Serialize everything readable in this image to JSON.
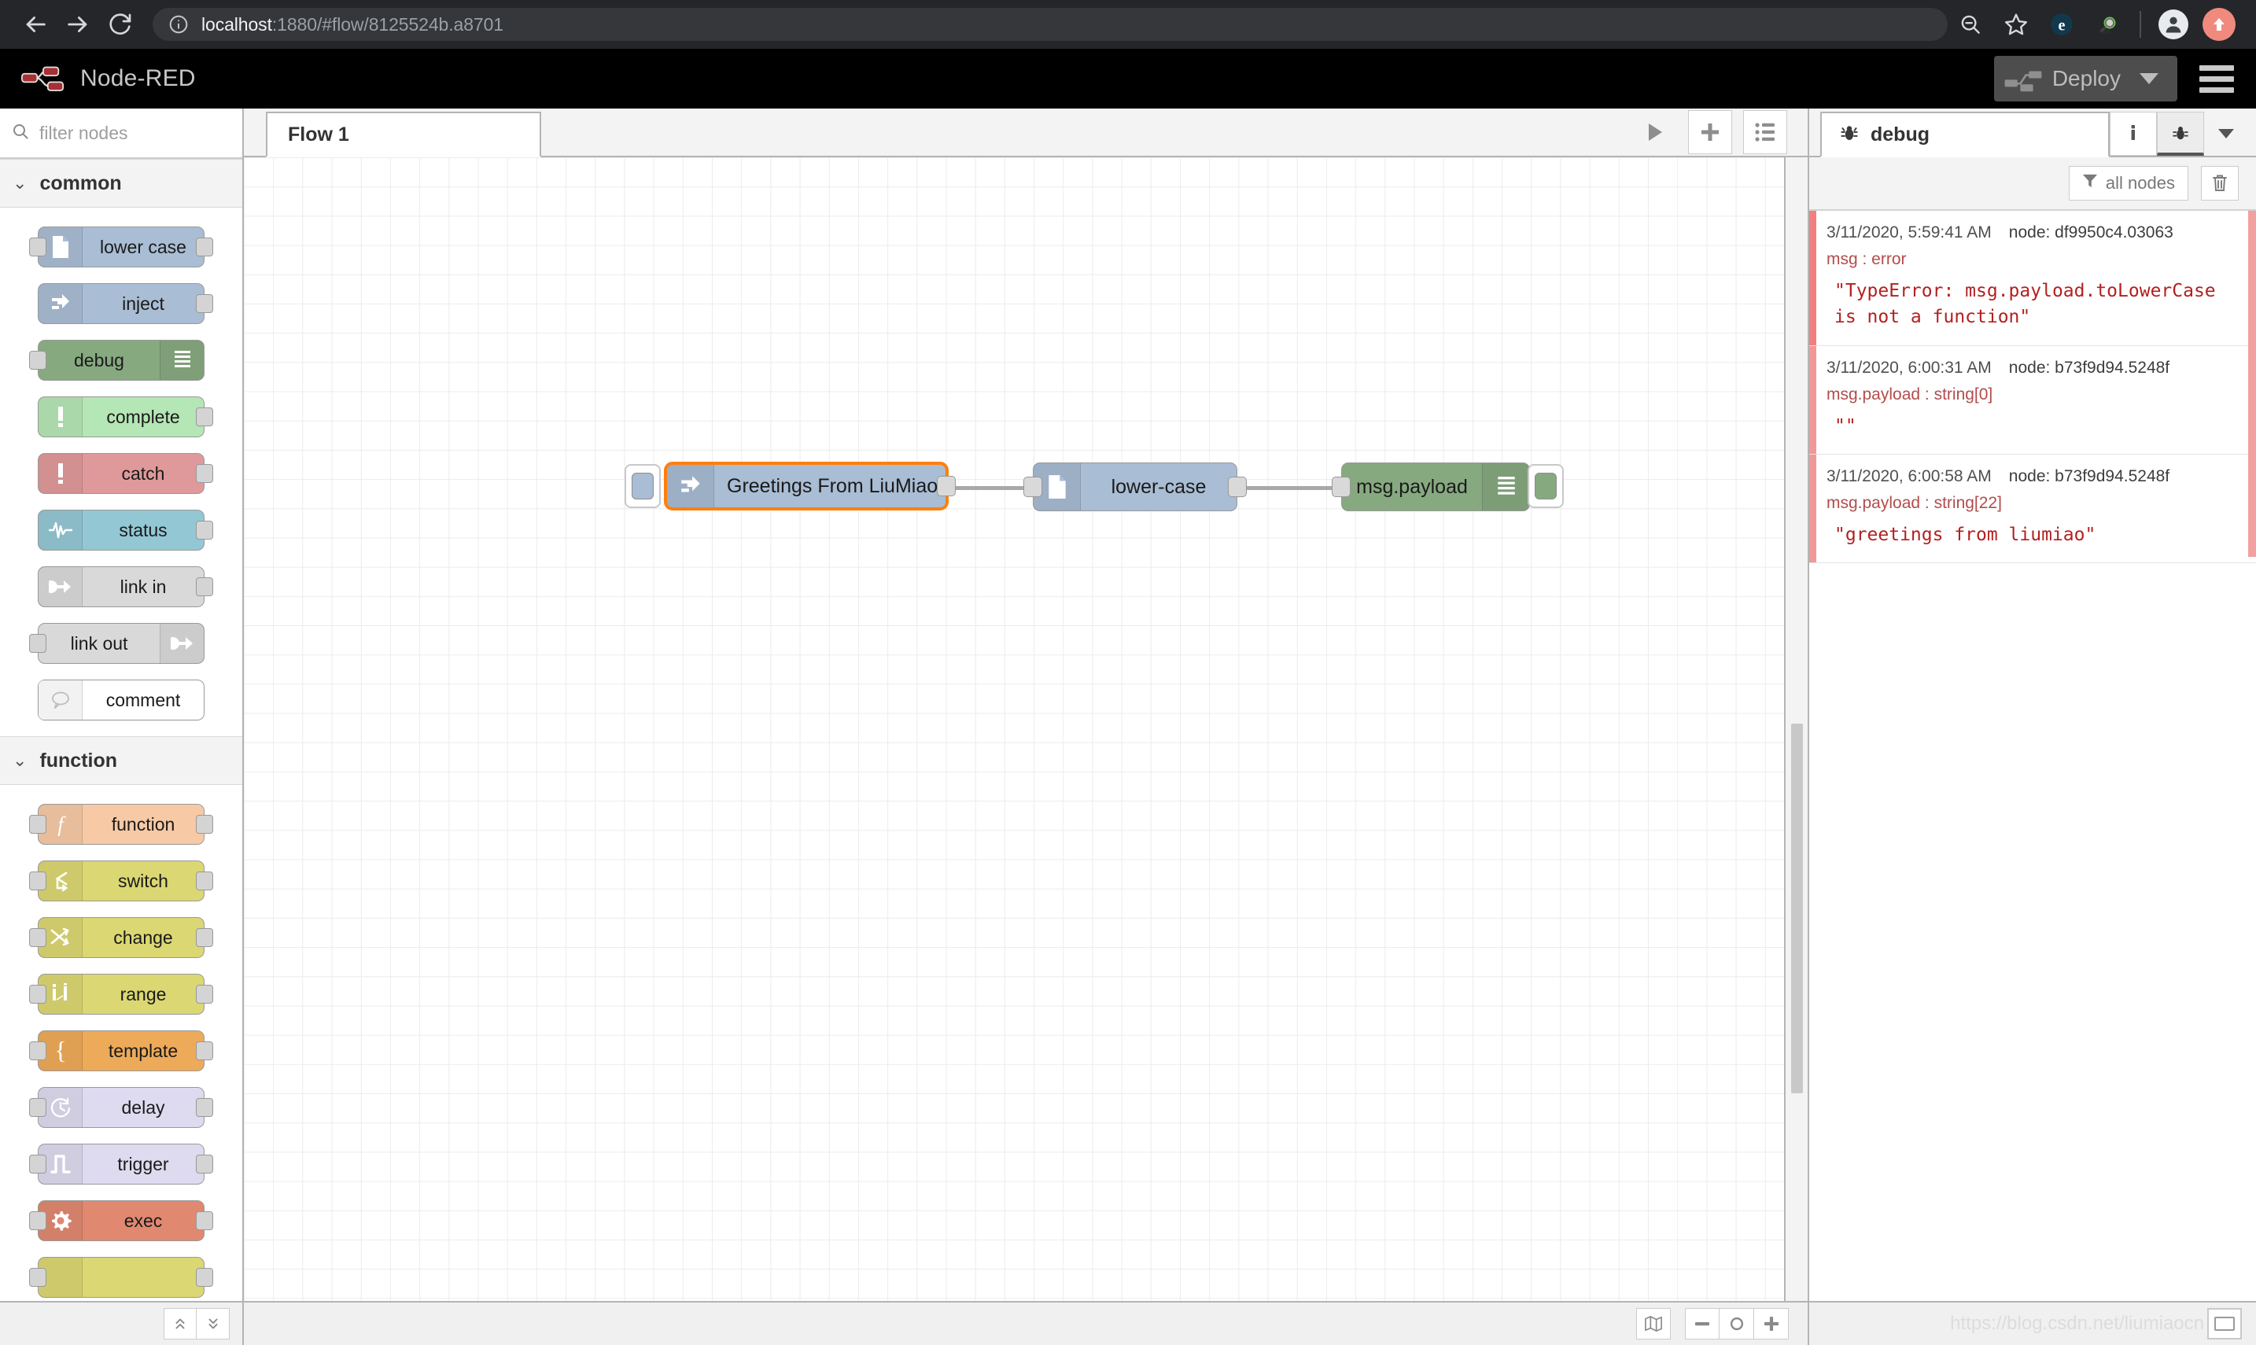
{
  "browser": {
    "url_host": "localhost",
    "url_rest": ":1880/#flow/8125524b.a8701",
    "back_icon": "arrow-left-icon",
    "forward_icon": "arrow-right-icon",
    "reload_icon": "reload-icon",
    "info_icon": "site-info-icon",
    "zoom_icon": "zoom-out-icon",
    "bookmark_icon": "star-icon",
    "ext1_icon": "extension-e-icon",
    "ext2_icon": "extension-magnifier-icon",
    "profile_icon": "profile-avatar-icon",
    "update_icon": "update-arrow-icon"
  },
  "nr_header": {
    "title": "Node-RED",
    "deploy_label": "Deploy",
    "deploy_icon": "deploy-node-icon",
    "caret_icon": "chevron-down-icon",
    "menu_icon": "hamburger-menu-icon"
  },
  "palette": {
    "search_placeholder": "filter nodes",
    "search_icon": "search-icon",
    "categories": [
      {
        "name": "common",
        "chevron": "chevron-down-icon",
        "nodes": [
          {
            "label": "lower case",
            "icon": "file-icon",
            "fill": "#a9bdd4",
            "icon_side": "left",
            "in": false,
            "out": true
          },
          {
            "label": "inject",
            "icon": "inject-arrow-icon",
            "fill": "#a9bdd4",
            "icon_side": "left",
            "in": false,
            "out": true
          },
          {
            "label": "debug",
            "icon": "debug-lines-icon",
            "fill": "#87a980",
            "icon_side": "right",
            "in": true,
            "out": false
          },
          {
            "label": "complete",
            "icon": "exclamation-icon",
            "fill": "#b5e6b5",
            "icon_side": "left",
            "in": false,
            "out": true
          },
          {
            "label": "catch",
            "icon": "exclamation-icon",
            "fill": "#e0999b",
            "icon_side": "left",
            "in": false,
            "out": true
          },
          {
            "label": "status",
            "icon": "pulse-icon",
            "fill": "#93c7d4",
            "icon_side": "left",
            "in": false,
            "out": true
          },
          {
            "label": "link in",
            "icon": "link-arrow-icon",
            "fill": "#d9d9d9",
            "icon_side": "left",
            "in": false,
            "out": true
          },
          {
            "label": "link out",
            "icon": "link-arrow-icon",
            "fill": "#d9d9d9",
            "icon_side": "right",
            "in": true,
            "out": false
          },
          {
            "label": "comment",
            "icon": "comment-bubble-icon",
            "fill": "#ffffff",
            "icon_side": "left",
            "in": false,
            "out": false
          }
        ]
      },
      {
        "name": "function",
        "chevron": "chevron-down-icon",
        "nodes": [
          {
            "label": "function",
            "icon": "function-f-icon",
            "fill": "#f7c9a5",
            "icon_side": "left",
            "in": true,
            "out": true
          },
          {
            "label": "switch",
            "icon": "switch-icon",
            "fill": "#dbd773",
            "icon_side": "left",
            "in": true,
            "out": true
          },
          {
            "label": "change",
            "icon": "change-swap-icon",
            "fill": "#dbd773",
            "icon_side": "left",
            "in": true,
            "out": true
          },
          {
            "label": "range",
            "icon": "range-icon",
            "fill": "#dbd773",
            "icon_side": "left",
            "in": true,
            "out": true
          },
          {
            "label": "template",
            "icon": "brace-icon",
            "fill": "#edaa59",
            "icon_side": "left",
            "in": true,
            "out": true
          },
          {
            "label": "delay",
            "icon": "stopwatch-icon",
            "fill": "#dedaf0",
            "icon_side": "left",
            "in": true,
            "out": true
          },
          {
            "label": "trigger",
            "icon": "pulse-step-icon",
            "fill": "#dedaf0",
            "icon_side": "left",
            "in": true,
            "out": true
          },
          {
            "label": "exec",
            "icon": "gear-icon",
            "fill": "#e08870",
            "icon_side": "left",
            "in": true,
            "out": true
          },
          {
            "label": "",
            "icon": "",
            "fill": "#dbd773",
            "icon_side": "left",
            "in": true,
            "out": true
          }
        ]
      }
    ],
    "footer": {
      "collapse_all_icon": "chevrons-up-icon",
      "expand_all_icon": "chevrons-down-icon"
    }
  },
  "tabbar": {
    "tabs": [
      {
        "label": "Flow 1"
      }
    ],
    "play_icon": "play-icon",
    "add_icon": "plus-icon",
    "list_icon": "list-icon"
  },
  "flow": {
    "nodes": [
      {
        "id": "inject-node",
        "label": "Greetings From LiuMiao",
        "fill": "#a9bdd4",
        "icon": "inject-arrow-icon",
        "icon_side": "left",
        "selected": true,
        "has_button": "left"
      },
      {
        "id": "lowercase-node",
        "label": "lower-case",
        "fill": "#a9bdd4",
        "icon": "file-icon",
        "icon_side": "left",
        "selected": false,
        "has_button": ""
      },
      {
        "id": "debug-node",
        "label": "msg.payload",
        "fill": "#87a980",
        "icon": "debug-lines-icon",
        "icon_side": "right",
        "selected": false,
        "has_button": "right"
      }
    ]
  },
  "canvas_footer": {
    "map_icon": "navigator-map-icon",
    "zoom_out_icon": "minus-icon",
    "zoom_reset_icon": "circle-icon",
    "zoom_in_icon": "plus-icon"
  },
  "sidebar": {
    "tab_label": "debug",
    "tab_icon": "bug-icon",
    "info_tab_icon": "info-i-icon",
    "debug_tab_icon": "bug-icon",
    "caret_icon": "chevron-down-icon",
    "filter_label": "all nodes",
    "filter_icon": "funnel-icon",
    "trash_icon": "trash-icon",
    "messages": [
      {
        "timestamp": "3/11/2020, 5:59:41 AM",
        "node": "node: df9950c4.03063",
        "topic": "msg : error",
        "payload": "\"TypeError: msg.payload.toLowerCase is not a function\"",
        "kind": "error"
      },
      {
        "timestamp": "3/11/2020, 6:00:31 AM",
        "node": "node: b73f9d94.5248f",
        "topic": "msg.payload : string[0]",
        "payload": "\"\"",
        "kind": "normal"
      },
      {
        "timestamp": "3/11/2020, 6:00:58 AM",
        "node": "node: b73f9d94.5248f",
        "topic": "msg.payload : string[22]",
        "payload": "\"greetings from liumiao\"",
        "kind": "normal"
      }
    ],
    "watermark": "https://blog.csdn.net/liumiaocn",
    "screen_icon": "monitor-icon"
  }
}
